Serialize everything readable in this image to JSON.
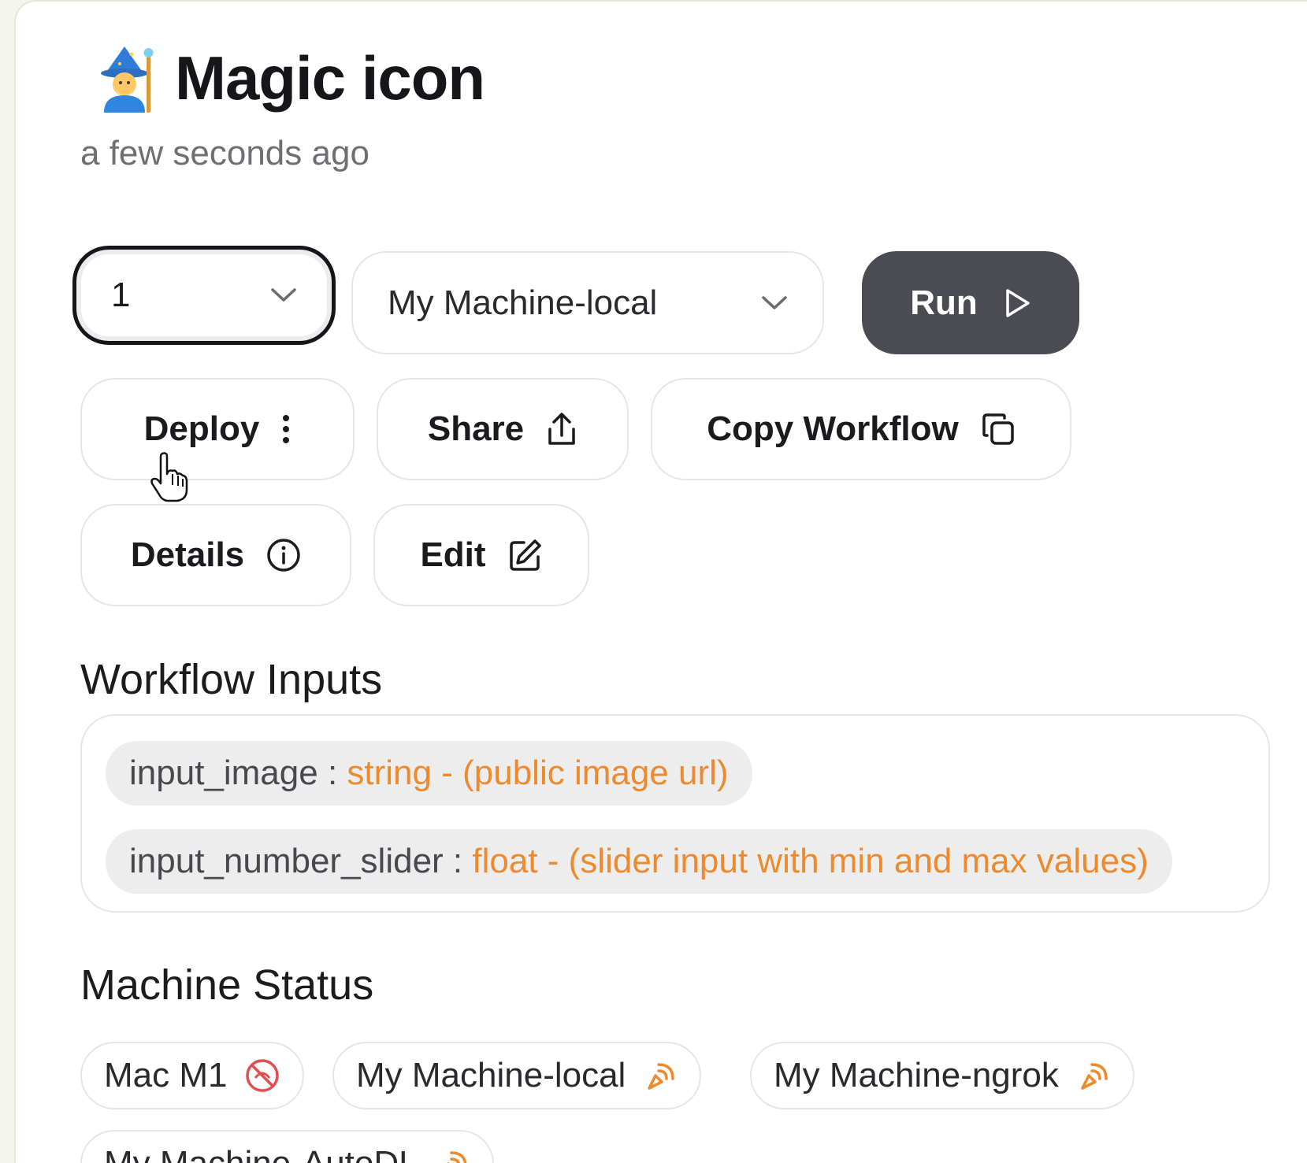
{
  "header": {
    "title": "Magic icon",
    "subtitle": "a few seconds ago",
    "icon": "wizard-emoji-icon"
  },
  "controls": {
    "version_value": "1",
    "machine_value": "My Machine-local",
    "run_label": "Run"
  },
  "actions": {
    "deploy_label": "Deploy",
    "share_label": "Share",
    "copy_label": "Copy Workflow",
    "details_label": "Details",
    "edit_label": "Edit"
  },
  "workflow_inputs": {
    "title": "Workflow Inputs",
    "items": [
      {
        "name": "input_image :",
        "type": "string - (public image url)"
      },
      {
        "name": "input_number_slider :",
        "type": "float - (slider input with min and max values)"
      }
    ]
  },
  "machine_status": {
    "title": "Machine Status",
    "items": [
      {
        "name": "Mac M1",
        "status_icon": "offline-icon"
      },
      {
        "name": "My Machine-local",
        "status_icon": "signal-icon"
      },
      {
        "name": "My Machine-ngrok",
        "status_icon": "signal-icon"
      },
      {
        "name": "My Machine-AutoDL",
        "status_icon": "signal-icon"
      }
    ]
  },
  "colors": {
    "accent_orange": "#ec8a2d",
    "offline_red": "#e24d4d",
    "run_bg": "#4b4c53"
  }
}
